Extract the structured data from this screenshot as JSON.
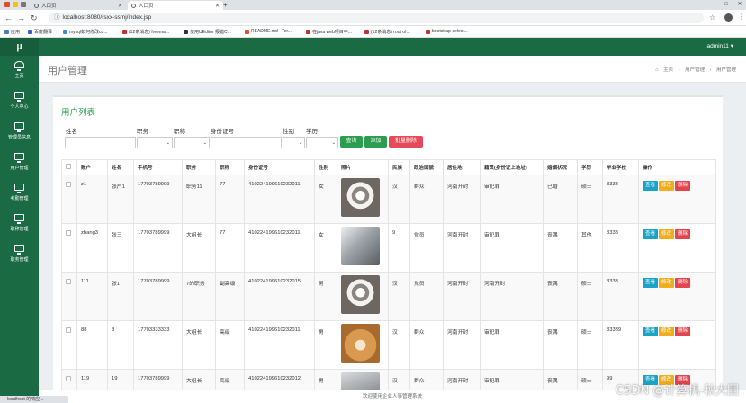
{
  "browser": {
    "tabs": [
      {
        "title": "入口页"
      },
      {
        "title": "入口页"
      }
    ],
    "url_host": "localhost",
    "url_path": ":8080/rsxx-ssmj/index.jsp",
    "bookmarks": [
      "应用",
      "百度翻译",
      "mysql如何修改co...",
      "(12条消息) freema...",
      "使用UEditor 报错C...",
      "README.md - Ter...",
      "在java web项目中...",
      "(12条消息) root of...",
      "bootstrap-select..."
    ]
  },
  "sidebar": {
    "logo": "µ",
    "items": [
      {
        "label": "主页"
      },
      {
        "label": "个人中心"
      },
      {
        "label": "管理员信息"
      },
      {
        "label": "用户管理"
      },
      {
        "label": "考勤管理"
      },
      {
        "label": "职称管理"
      },
      {
        "label": "职务管理"
      }
    ]
  },
  "header": {
    "user": "admin11 ▾"
  },
  "page": {
    "title": "用户管理",
    "breadcrumb": [
      "主页",
      "用户管理",
      "用户管理"
    ],
    "breadcrumb_sep": "›"
  },
  "panel": {
    "title": "用户列表",
    "filters": {
      "name_label": "姓名",
      "duty_label": "职务",
      "rank_label": "职称",
      "id_label": "身份证号",
      "gender_label": "性别",
      "edu_label": "学历"
    },
    "buttons": {
      "search": "查询",
      "add": "添加",
      "batch_delete": "批量删除"
    }
  },
  "table": {
    "headers": [
      "",
      "账户",
      "姓名",
      "手机号",
      "职务",
      "职称",
      "身份证号",
      "性别",
      "照片",
      "民族",
      "政治面貌",
      "居住地",
      "籍贯(身份证上地址)",
      "婚姻状况",
      "学历",
      "毕业学校",
      "操作"
    ],
    "actions": {
      "view": "查看",
      "edit": "修改",
      "delete": "删除"
    },
    "rows": [
      {
        "account": "z1",
        "name": "张户1",
        "phone": "17703789999",
        "duty": "职务11",
        "rank": "77",
        "idno": "410224199610232011",
        "gender": "女",
        "ethnic": "汉",
        "political": "群众",
        "residence": "河南开封",
        "native": "审犯罪",
        "marital": "已婚",
        "edu": "硕士",
        "school": "3333"
      },
      {
        "account": "zhang3",
        "name": "张三",
        "phone": "17703789999",
        "duty": "大组长",
        "rank": "77",
        "idno": "410224199610232011",
        "gender": "女",
        "ethnic": "9",
        "political": "党员",
        "residence": "河南开封",
        "native": "审犯罪",
        "marital": "丧偶",
        "edu": "其他",
        "school": "3333"
      },
      {
        "account": "111",
        "name": "张1",
        "phone": "17703789999",
        "duty": "7的职务",
        "rank": "副高级",
        "idno": "410224199610232015",
        "gender": "男",
        "ethnic": "汉",
        "political": "党员",
        "residence": "河南开封",
        "native": "河南开封",
        "marital": "丧偶",
        "edu": "硕士",
        "school": "3333"
      },
      {
        "account": "88",
        "name": "8",
        "phone": "17703333333",
        "duty": "大组长",
        "rank": "高级",
        "idno": "410224199610232011",
        "gender": "男",
        "ethnic": "汉",
        "political": "群众",
        "residence": "河南开封",
        "native": "审犯罪",
        "marital": "丧偶",
        "edu": "硕士",
        "school": "33339"
      },
      {
        "account": "119",
        "name": "19",
        "phone": "17703789999",
        "duty": "大组长",
        "rank": "高级",
        "idno": "410224199610232012",
        "gender": "男",
        "ethnic": "汉",
        "political": "群众",
        "residence": "河南开封",
        "native": "审犯罪",
        "marital": "丧偶",
        "edu": "硕士",
        "school": "99"
      }
    ]
  },
  "footer": {
    "text": "欢迎使用企业人事管理系统"
  },
  "status": {
    "text": "localhost 的响应..."
  },
  "watermark": "CSDN @计算机-秋大田",
  "colors": {
    "sidebar": "#1a6a44",
    "accent_green": "#2a9d4e",
    "danger": "#e3454f",
    "info": "#1ba3c6",
    "warning": "#f0ad1f"
  }
}
